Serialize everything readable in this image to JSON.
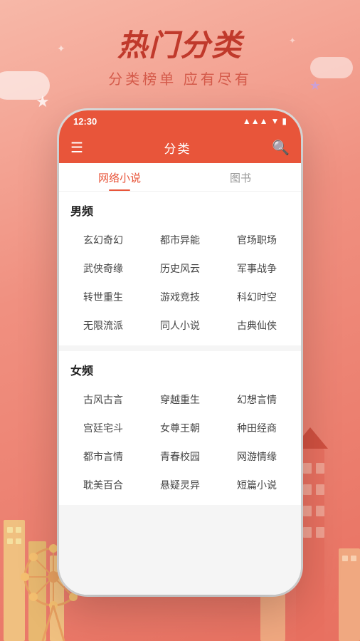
{
  "app": {
    "title": "热门分类",
    "subtitle": "分类榜单  应有尽有"
  },
  "status_bar": {
    "time": "12:30",
    "signal_icon": "▲▲▲",
    "wifi_icon": "▼",
    "battery_icon": "▮"
  },
  "nav": {
    "menu_icon": "☰",
    "title": "分类",
    "search_icon": "🔍"
  },
  "tabs": [
    {
      "label": "网络小说",
      "active": true
    },
    {
      "label": "图书",
      "active": false
    }
  ],
  "sections": [
    {
      "title": "男频",
      "items": [
        "玄幻奇幻",
        "都市异能",
        "官场职场",
        "武侠奇缘",
        "历史风云",
        "军事战争",
        "转世重生",
        "游戏竞技",
        "科幻时空",
        "无限流派",
        "同人小说",
        "古典仙侠"
      ]
    },
    {
      "title": "女频",
      "items": [
        "古风古言",
        "穿越重生",
        "幻想言情",
        "宫廷宅斗",
        "女尊王朝",
        "种田经商",
        "都市言情",
        "青春校园",
        "网游情缘",
        "耽美百合",
        "悬疑灵异",
        "短篇小说"
      ]
    }
  ],
  "colors": {
    "primary": "#e8553a",
    "background": "#f5a090",
    "text_dark": "#222222",
    "text_muted": "#999999"
  }
}
